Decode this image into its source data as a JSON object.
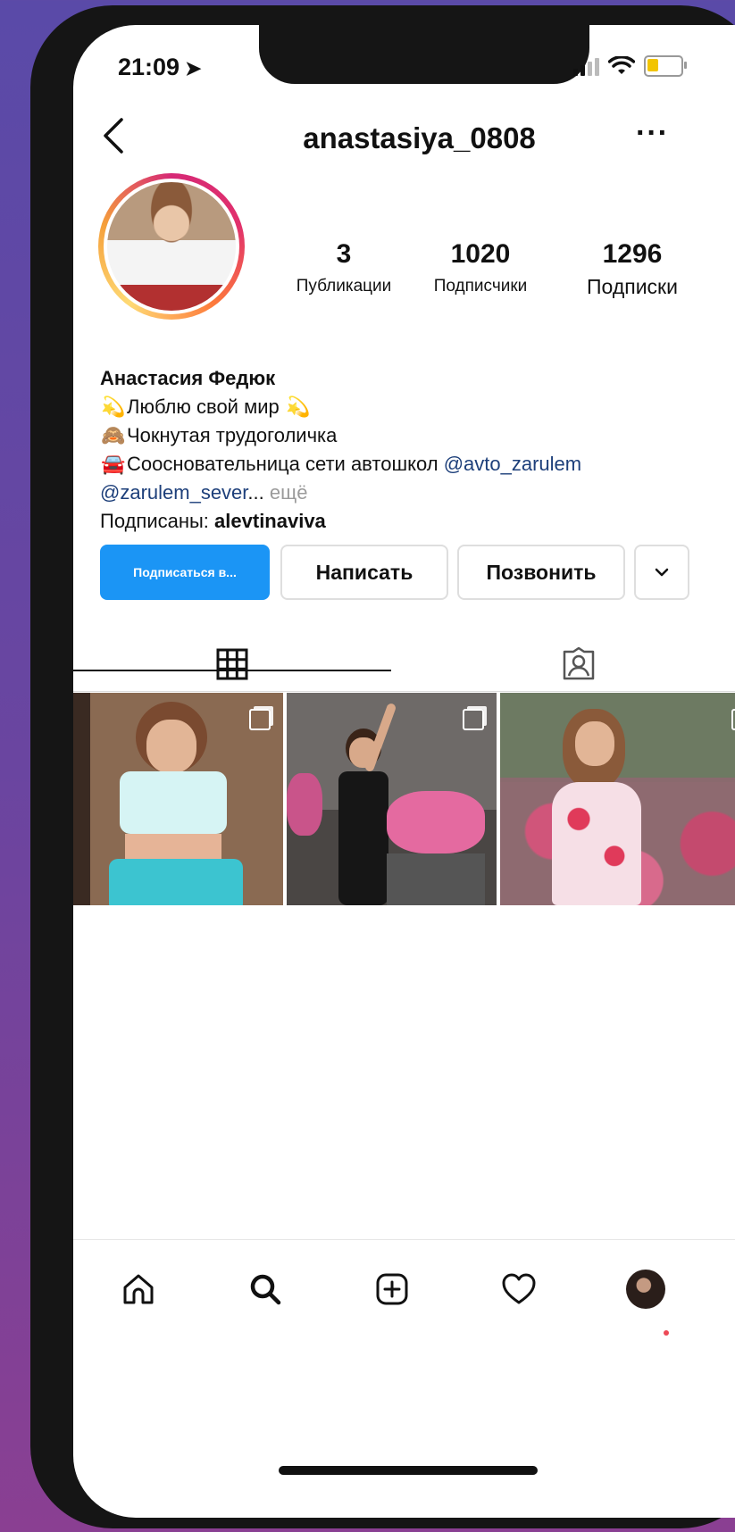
{
  "status_bar": {
    "time": "21:09",
    "location_icon": "location-arrow-icon",
    "battery_color": "#f2c400"
  },
  "header": {
    "username": "anastasiya_0808",
    "back_icon": "chevron-left-icon",
    "more_label": "···"
  },
  "profile": {
    "stats": {
      "posts": {
        "value": "3",
        "label": "Публикации"
      },
      "followers": {
        "value": "1020",
        "label": "Подписчики"
      },
      "following": {
        "value": "1296",
        "label": "Подписки"
      }
    },
    "bio": {
      "name": "Анастасия Федюк",
      "line1": "Люблю свой мир",
      "line2": "Чокнутая трудоголичка",
      "line3": "Соосновательница сети автошкол",
      "mention1": "@avto_zarulem",
      "mention2": "@zarulem_sever",
      "ellipsis": "...",
      "more": "ещё",
      "followed_by_label": "Подписаны:",
      "followed_by_user": "alevtinaviva"
    }
  },
  "actions": {
    "follow": "Подписаться в...",
    "message": "Написать",
    "call": "Позвонить",
    "dropdown": "⌄"
  },
  "colors": {
    "accent": "#1b95f5",
    "link": "#1d3f7a",
    "notification_dot": "#ed4956"
  }
}
